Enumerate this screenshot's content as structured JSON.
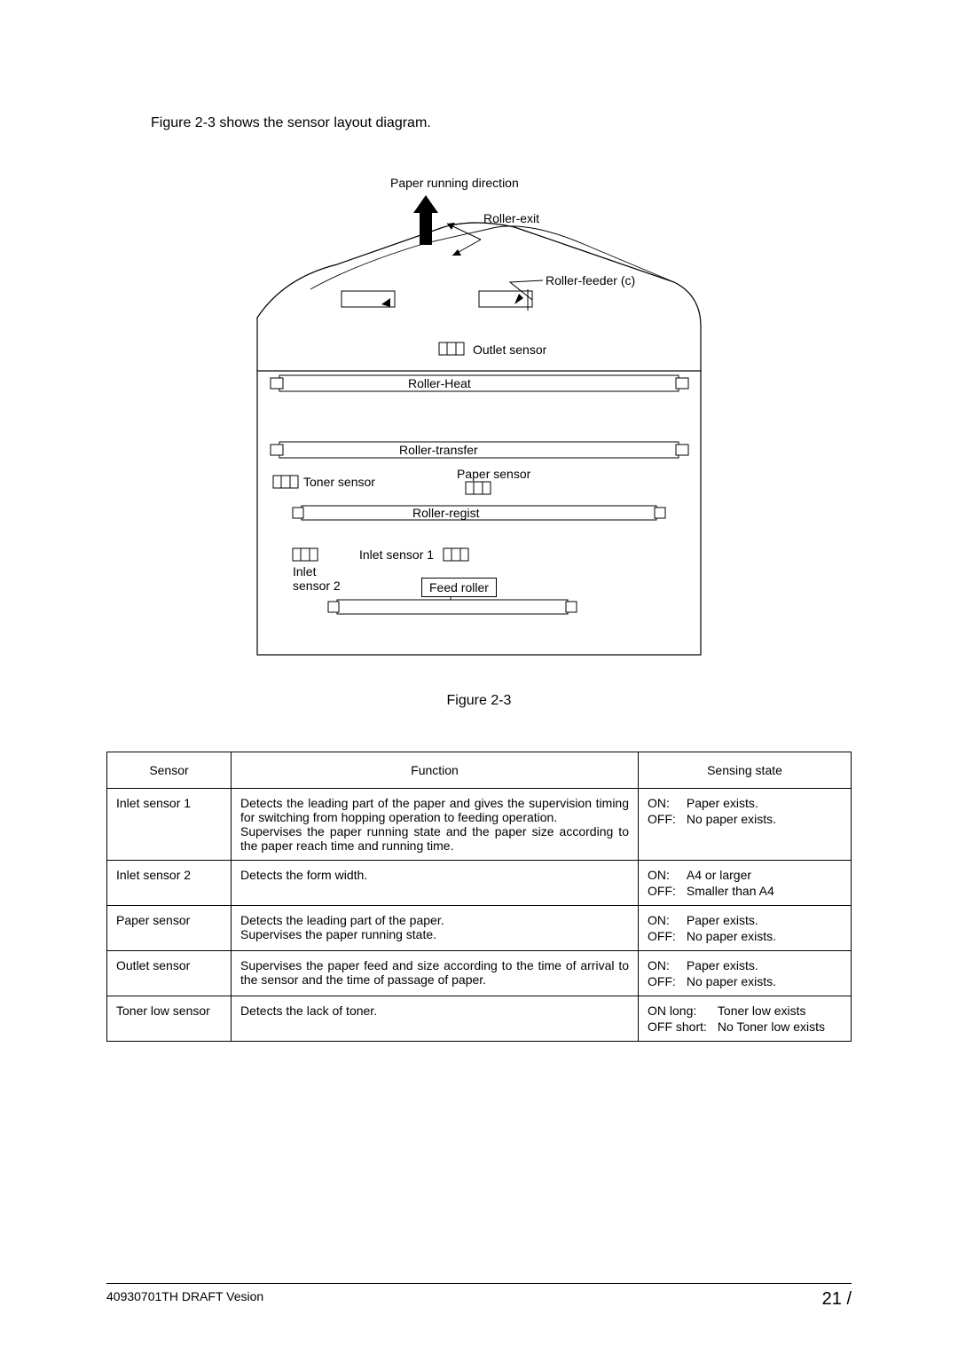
{
  "intro": "Figure 2-3 shows the sensor layout diagram.",
  "diagram": {
    "paper_running_direction": "Paper running direction",
    "roller_exit": "Roller-exit",
    "roller_feeder_c": "Roller-feeder (c)",
    "outlet_sensor": "Outlet sensor",
    "roller_heat": "Roller-Heat",
    "roller_transfer": "Roller-transfer",
    "toner_sensor": "Toner sensor",
    "paper_sensor": "Paper sensor",
    "roller_regist": "Roller-regist",
    "inlet_sensor_1": "Inlet sensor 1",
    "inlet_sensor_2_line1": "Inlet",
    "inlet_sensor_2_line2": "sensor 2",
    "feed_roller": "Feed roller"
  },
  "figure_caption": "Figure 2-3",
  "table": {
    "headers": {
      "sensor": "Sensor",
      "function": "Function",
      "state": "Sensing state"
    },
    "rows": [
      {
        "sensor": "Inlet sensor 1",
        "function": "Detects the leading part of the paper and gives the supervision timing for switching from hopping operation to feeding operation.\nSupervises the paper running state and the paper size according to the paper reach time and running time.",
        "state": [
          {
            "k": "ON:",
            "v": "Paper exists."
          },
          {
            "k": "OFF:",
            "v": "No paper exists."
          }
        ]
      },
      {
        "sensor": "Inlet sensor 2",
        "function": "Detects the form width.",
        "state": [
          {
            "k": "ON:",
            "v": "A4 or larger"
          },
          {
            "k": "OFF:",
            "v": "Smaller than A4"
          }
        ]
      },
      {
        "sensor": "Paper sensor",
        "function": "Detects the leading part of the paper.\nSupervises the paper running state.",
        "state": [
          {
            "k": "ON:",
            "v": "Paper exists."
          },
          {
            "k": "OFF:",
            "v": "No paper exists."
          }
        ]
      },
      {
        "sensor": "Outlet sensor",
        "function": "Supervises the paper feed and size according to the time of arrival to the sensor and the time of passage of paper.",
        "state": [
          {
            "k": "ON:",
            "v": "Paper exists."
          },
          {
            "k": "OFF:",
            "v": "No paper exists."
          }
        ]
      },
      {
        "sensor": "Toner low sensor",
        "function": "Detects the lack of toner.",
        "state": [
          {
            "k": "ON long:",
            "v": "Toner low exists"
          },
          {
            "k": "OFF short:",
            "v": "No Toner low exists"
          }
        ]
      }
    ]
  },
  "footer": {
    "left": "40930701TH  DRAFT Vesion",
    "page": "21 /"
  }
}
